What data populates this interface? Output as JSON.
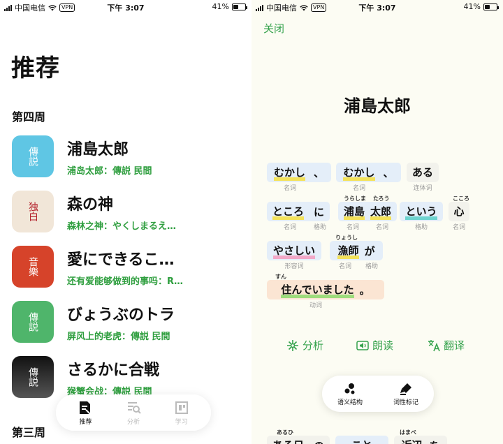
{
  "status": {
    "carrier": "中国电信",
    "vpn": "VPN",
    "time": "下午 3:07",
    "battery": "41%",
    "battery_level": 0.41
  },
  "left": {
    "title": "推荐",
    "sections": [
      "第四周",
      "第三周"
    ],
    "items": [
      {
        "title": "浦島太郎",
        "subtitle": "浦岛太郎：傳説 民間",
        "thumb_text": "傳説",
        "thumb_bg": "#5fc6e4",
        "thumb_fg": "#ffffff"
      },
      {
        "title": "森の神",
        "subtitle": "森林之神：やくしまるえ…",
        "thumb_text": "独白",
        "thumb_bg": "#f1e6d8",
        "thumb_fg": "#b3202a"
      },
      {
        "title": "愛にできるこ…",
        "subtitle": "还有爱能够做到的事吗：R…",
        "thumb_text": "音樂",
        "thumb_bg": "#d6432a",
        "thumb_fg": "#ffffff"
      },
      {
        "title": "びょうぶのトラ",
        "subtitle": "屏风上的老虎：傳説 民間",
        "thumb_text": "傳説",
        "thumb_bg": "#4fb56b",
        "thumb_fg": "#ffffff"
      },
      {
        "title": "さるかに合戦",
        "subtitle": "猴蟹会战：傳説 民間",
        "thumb_text": "傳説",
        "thumb_bg": "#222222",
        "thumb_fg": "#ffffff"
      }
    ],
    "tabs": [
      {
        "label": "推荐",
        "icon": "recommend-icon",
        "active": true
      },
      {
        "label": "分析",
        "icon": "analysis-icon",
        "active": false
      },
      {
        "label": "学习",
        "icon": "study-icon",
        "active": false
      }
    ]
  },
  "right": {
    "close": "关闭",
    "story_title": "浦島太郎",
    "words": {
      "w1": {
        "text": "むかし",
        "pos": "名词"
      },
      "w2": {
        "text": "、"
      },
      "w3": {
        "text": "むかし",
        "pos": "名词"
      },
      "w4": {
        "text": "、"
      },
      "w5": {
        "text": "ある",
        "pos": "连体词"
      },
      "w6": {
        "text": "ところ",
        "pos": "名词"
      },
      "w7": {
        "text": "に",
        "pos": "格助"
      },
      "w8": {
        "text": "浦島",
        "ruby": "うらしま",
        "pos": "名词"
      },
      "w9": {
        "text": "太郎",
        "ruby": "たろう",
        "pos": "名词"
      },
      "w10": {
        "text": "という",
        "pos": "格助"
      },
      "w11": {
        "text": "心",
        "ruby": "こころ",
        "pos": "名词"
      },
      "w12": {
        "text": "やさしい",
        "pos": "形容词"
      },
      "w13": {
        "text": "漁師",
        "ruby": "りょうし",
        "pos": "名词"
      },
      "w14": {
        "text": "が",
        "pos": "格助"
      },
      "w15": {
        "text": "住んでいました",
        "ruby": "すん",
        "pos": "动词"
      },
      "w16": {
        "text": "。"
      },
      "w17": {
        "text": "ある日",
        "ruby": "あるひ"
      },
      "w18": {
        "text": "の"
      },
      "w19": {
        "text": "こと"
      },
      "w20": {
        "text": "近辺",
        "ruby": "はまべ"
      },
      "w21": {
        "text": "を"
      }
    },
    "actions": {
      "analyze": "分析",
      "read": "朗读",
      "translate": "翻译"
    },
    "floating": {
      "semantic": "语义结构",
      "pos_tag": "词性标记"
    }
  }
}
